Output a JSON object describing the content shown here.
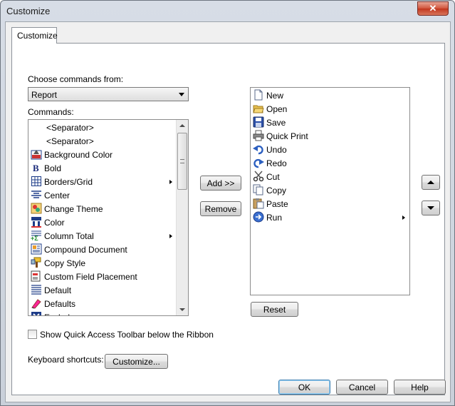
{
  "window": {
    "title": "Customize",
    "close_label": "✕"
  },
  "tab": {
    "label": "Customize"
  },
  "choose": {
    "label": "Choose commands from:",
    "selected": "Report"
  },
  "commands": {
    "label": "Commands:",
    "items": [
      {
        "label": "<Separator>",
        "icon": "none",
        "submenu": false
      },
      {
        "label": "<Separator>",
        "icon": "none",
        "submenu": false
      },
      {
        "label": "Background Color",
        "icon": "background-color-icon",
        "submenu": false
      },
      {
        "label": "Bold",
        "icon": "bold-icon",
        "submenu": false
      },
      {
        "label": "Borders/Grid",
        "icon": "borders-grid-icon",
        "submenu": true
      },
      {
        "label": "Center",
        "icon": "center-align-icon",
        "submenu": false
      },
      {
        "label": "Change Theme",
        "icon": "change-theme-icon",
        "submenu": false
      },
      {
        "label": "Color",
        "icon": "color-icon",
        "submenu": false
      },
      {
        "label": "Column Total",
        "icon": "column-total-icon",
        "submenu": true
      },
      {
        "label": "Compound Document",
        "icon": "compound-document-icon",
        "submenu": false
      },
      {
        "label": "Copy Style",
        "icon": "copy-style-icon",
        "submenu": false
      },
      {
        "label": "Custom Field Placement",
        "icon": "custom-field-placement-icon",
        "submenu": false
      },
      {
        "label": "Default",
        "icon": "default-icon",
        "submenu": false
      },
      {
        "label": "Defaults",
        "icon": "defaults-icon",
        "submenu": false
      },
      {
        "label": "Exclude",
        "icon": "exclude-icon",
        "submenu": false
      }
    ]
  },
  "actions": {
    "add": "Add >>",
    "remove": "Remove",
    "reset": "Reset"
  },
  "quick_access": {
    "items": [
      {
        "label": "New",
        "icon": "new-document-icon",
        "submenu": false
      },
      {
        "label": "Open",
        "icon": "open-folder-icon",
        "submenu": false
      },
      {
        "label": "Save",
        "icon": "save-icon",
        "submenu": false
      },
      {
        "label": "Quick Print",
        "icon": "printer-icon",
        "submenu": false
      },
      {
        "label": "Undo",
        "icon": "undo-icon",
        "submenu": false
      },
      {
        "label": "Redo",
        "icon": "redo-icon",
        "submenu": false
      },
      {
        "label": "Cut",
        "icon": "scissors-icon",
        "submenu": false
      },
      {
        "label": "Copy",
        "icon": "copy-icon",
        "submenu": false
      },
      {
        "label": "Paste",
        "icon": "paste-icon",
        "submenu": false
      },
      {
        "label": "Run",
        "icon": "run-icon",
        "submenu": true
      }
    ]
  },
  "move": {
    "up_icon": "arrow-up-icon",
    "down_icon": "arrow-down-icon"
  },
  "show_below": {
    "label": "Show Quick Access Toolbar below the Ribbon",
    "checked": false
  },
  "keyboard": {
    "label": "Keyboard shortcuts:",
    "button": "Customize..."
  },
  "footer": {
    "ok": "OK",
    "cancel": "Cancel",
    "help": "Help"
  },
  "colors": {
    "accent_blue": "#3c7fb1",
    "close_red": "#c1361e"
  }
}
